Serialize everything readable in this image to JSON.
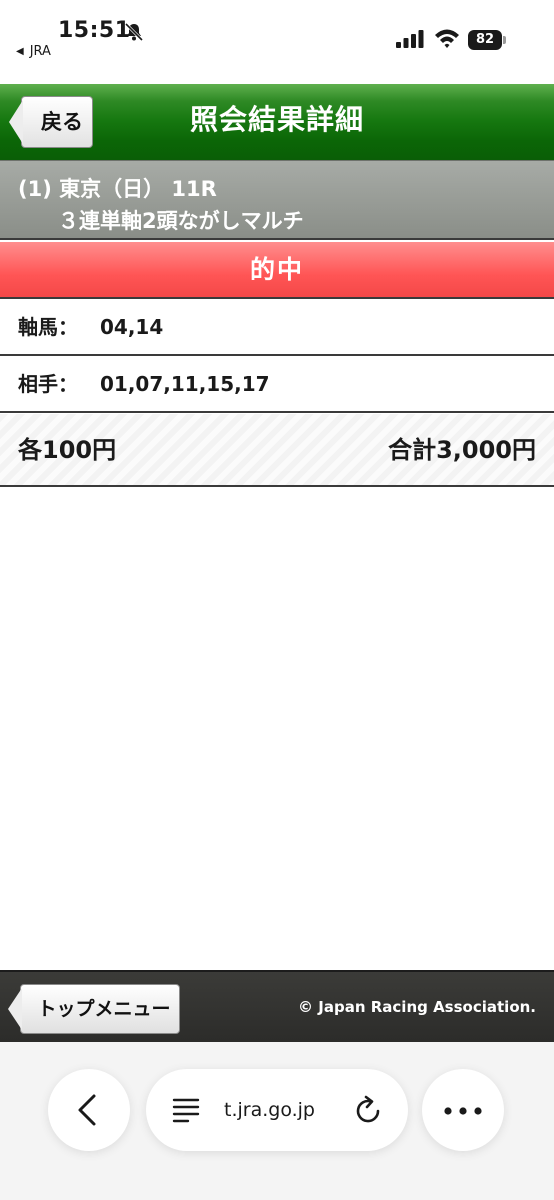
{
  "status_bar": {
    "time": "15:51",
    "back_app": "JRA",
    "battery": "82",
    "icons": [
      "bell-off-icon",
      "signal-icon",
      "wifi-icon",
      "battery-icon"
    ]
  },
  "header": {
    "back_label": "戻る",
    "title": "照会結果詳細",
    "color": "#167810"
  },
  "race": {
    "line1": "(1) 東京（日） 11R",
    "line2": "３連単軸2頭ながしマルチ"
  },
  "result": {
    "label": "的中",
    "color": "#ff5555"
  },
  "rows": {
    "jiku_label": "軸馬：",
    "jiku_value": "04,14",
    "aite_label": "相手：",
    "aite_value": "01,07,11,15,17"
  },
  "totals": {
    "each": "各100円",
    "sum": "合計3,000円"
  },
  "footer": {
    "top_menu_label": "トップメニュー",
    "copyright": "© Japan Racing Association."
  },
  "browser": {
    "url": "t.jra.go.jp",
    "icons": [
      "chevron-left-icon",
      "reader-icon",
      "reload-icon",
      "more-icon"
    ]
  }
}
